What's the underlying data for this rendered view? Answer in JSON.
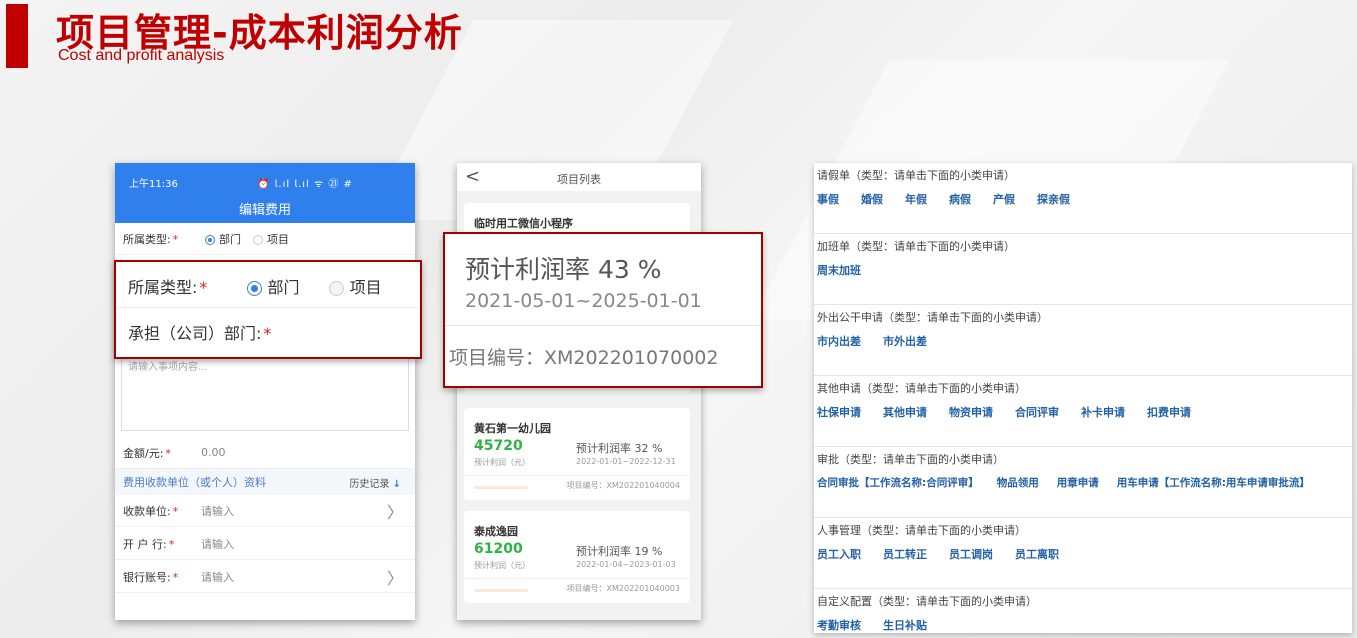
{
  "slide": {
    "title": "项目管理-成本利润分析",
    "subtitle": "Cost and profit analysis",
    "accent_color": "#c00000"
  },
  "phone_edit": {
    "status_time": "上午11:36",
    "status_icons": "⏰ 𝗅.ıl 𝗅.ıl ᯤ ㉑ #",
    "title": "编辑费用",
    "category_label": "所属类型:",
    "option_dept": "部门",
    "option_project": "项目",
    "textarea_placeholder": "请输入事项内容...",
    "amount_label": "金额/元:",
    "amount_value": "0.00",
    "section_title": "费用收款单位（或个人）资料",
    "history_label": "历史记录",
    "history_icon": "↓",
    "payee_label": "收款单位:",
    "payee_placeholder": "请输入",
    "bank_label": "开 户 行:",
    "bank_placeholder": "请输入",
    "account_label": "银行账号:",
    "account_placeholder": "请输入",
    "required_mark": "*",
    "chevron": "〉",
    "accent_color": "#2f80ed"
  },
  "zoom_form": {
    "category_label": "所属类型:",
    "option_dept": "部门",
    "option_project": "项目",
    "bearer_label": "承担（公司）部门:",
    "required_mark": "*"
  },
  "phone_list": {
    "back_icon": "<",
    "title": "项目列表",
    "top_card_name": "临时用工微信小程序",
    "cards": [
      {
        "name": "黄石第一幼儿园",
        "profit": "45720",
        "profit_label": "预计利润（元）",
        "rate": "预计利润率 32 %",
        "dates": "2022-01-01~2022-12-31",
        "code": "项目编号：XM202201040004"
      },
      {
        "name": "泰成逸园",
        "profit": "61200",
        "profit_label": "预计利润（元）",
        "rate": "预计利润率 19 %",
        "dates": "2022-01-04~2023-01-03",
        "code": "项目编号：XM202201040003"
      }
    ]
  },
  "zoom_card": {
    "rate": "预计利润率 43 %",
    "dates": "2021-05-01~2025-01-01",
    "code": "项目编号：XM202201070002"
  },
  "request_panel": {
    "groups": [
      {
        "title": "请假单（类型：请单击下面的小类申请）",
        "items": [
          "事假",
          "婚假",
          "年假",
          "病假",
          "产假",
          "探亲假"
        ]
      },
      {
        "title": "加班单（类型：请单击下面的小类申请）",
        "items": [
          "周末加班"
        ]
      },
      {
        "title": "外出公干申请（类型：请单击下面的小类申请）",
        "items": [
          "市内出差",
          "市外出差"
        ]
      },
      {
        "title": "其他申请（类型：请单击下面的小类申请）",
        "items": [
          "社保申请",
          "其他申请",
          "物资申请",
          "合同评审",
          "补卡申请",
          "扣费申请"
        ]
      },
      {
        "title": "审批（类型：请单击下面的小类申请）",
        "items": [
          "合同审批【工作流名称:合同评审】",
          "物品领用",
          "用章申请",
          "用车申请【工作流名称:用车申请审批流】"
        ]
      },
      {
        "title": "人事管理（类型：请单击下面的小类申请）",
        "items": [
          "员工入职",
          "员工转正",
          "员工调岗",
          "员工离职"
        ]
      },
      {
        "title": "自定义配置（类型：请单击下面的小类申请）",
        "items": [
          "考勤审核",
          "生日补贴"
        ]
      }
    ]
  }
}
